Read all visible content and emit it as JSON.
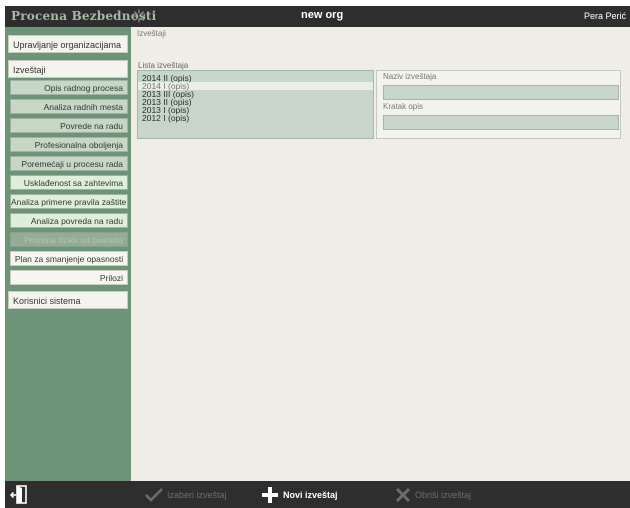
{
  "header": {
    "app_title": "Procena Bezbednosti",
    "organization": "new org",
    "user": "Pera Perić"
  },
  "sidebar": {
    "manage_org": "Upravljanje organizacijama",
    "reports": "Izveštaji",
    "report_items": [
      {
        "label": "Opis radnog procesa",
        "style": "normal"
      },
      {
        "label": "Analiza radnih mesta",
        "style": "normal"
      },
      {
        "label": "Povrede na radu",
        "style": "normal"
      },
      {
        "label": "Profesionalna oboljenja",
        "style": "normal"
      },
      {
        "label": "Poremećaji u procesu rada",
        "style": "normal"
      },
      {
        "label": "Usklađenost sa zahtevima",
        "style": "light"
      },
      {
        "label": "Analiza primene pravila zaštite",
        "style": "light"
      },
      {
        "label": "Analiza povreda na radu",
        "style": "light"
      },
      {
        "label": "Procena rizika od povreda",
        "style": "disabled"
      },
      {
        "label": "Plan za smanjenje opasnosti",
        "style": "white"
      },
      {
        "label": "Prilozi",
        "style": "white"
      }
    ],
    "system_users": "Korisnici sistema"
  },
  "main": {
    "breadcrumb": "Izveštaji",
    "list_label": "Lista izveštaja",
    "reports": [
      {
        "label": "2014 II (opis)",
        "selected": false
      },
      {
        "label": "2014 I (opis)",
        "selected": true
      },
      {
        "label": "2013 III (opis)",
        "selected": false
      },
      {
        "label": "2013 II (opis)",
        "selected": false
      },
      {
        "label": "2013 I (opis)",
        "selected": false
      },
      {
        "label": "2012 I (opis)",
        "selected": false
      }
    ],
    "name_label": "Naziv izveštaja",
    "name_value": "",
    "desc_label": "Kratak opis",
    "desc_value": ""
  },
  "toolbar": {
    "select": "Izaberi izveštaj",
    "new": "Novi izveštaj",
    "delete": "Obriši izveštaj"
  },
  "icons": {
    "exit": "exit-door-icon",
    "select": "check-icon",
    "new": "plus-icon",
    "delete": "x-icon",
    "loading": "spinner-icon"
  },
  "colors": {
    "topbar": "#2e2e2e",
    "sidebar": "#6e9478",
    "content_bg": "#efeee6",
    "list_bg": "#c7d6c9",
    "title_green": "#a6b9a4"
  }
}
